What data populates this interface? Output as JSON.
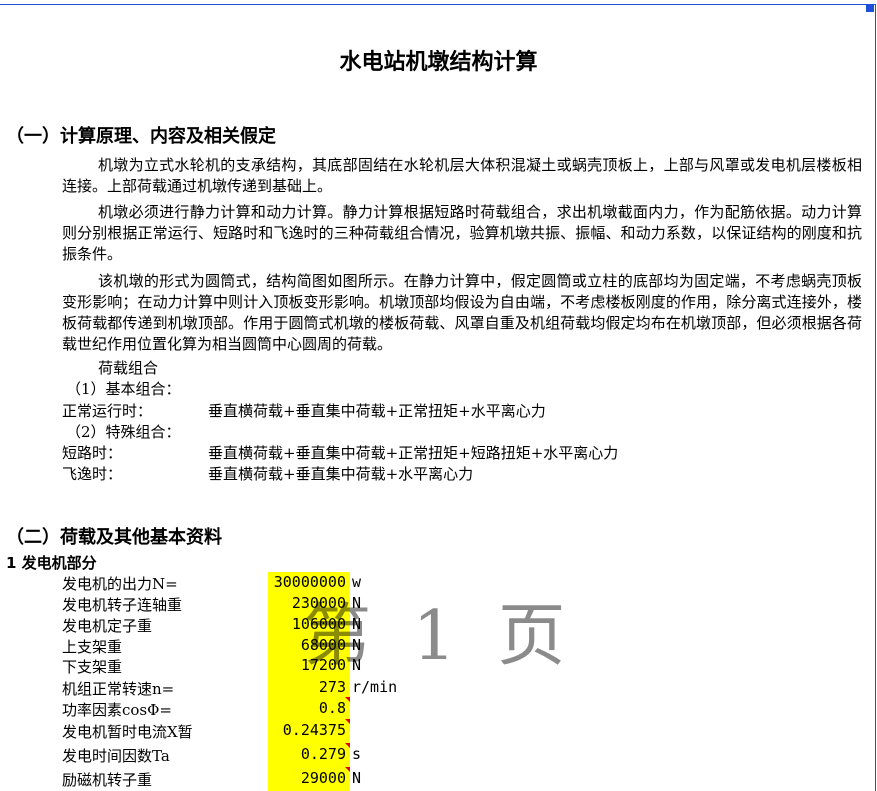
{
  "title": "水电站机墩结构计算",
  "section1": {
    "heading": "（一）计算原理、内容及相关假定",
    "paragraphs": [
      "机墩为立式水轮机的支承结构，其底部固结在水轮机层大体积混凝土或蜗壳顶板上，上部与风罩或发电机层楼板相连接。上部荷载通过机墩传递到基础上。",
      "机墩必须进行静力计算和动力计算。静力计算根据短路时荷载组合，求出机墩截面内力，作为配筋依据。动力计算则分别根据正常运行、短路时和飞逸时的三种荷载组合情况，验算机墩共振、振幅、和动力系数，以保证结构的刚度和抗振条件。",
      "该机墩的形式为圆筒式，结构简图如图所示。在静力计算中，假定圆筒或立柱的底部均为固定端，不考虑蜗壳顶板变形影响；在动力计算中则计入顶板变形影响。机墩顶部均假设为自由端，不考虑楼板刚度的作用，除分离式连接外，楼板荷载都传递到机墩顶部。作用于圆筒式机墩的楼板荷载、风罩自重及机组荷载均假定均布在机墩顶部，但必须根据各荷载世纪作用位置化算为相当圆筒中心圆周的荷载。"
    ],
    "combo_title": "荷载组合",
    "basic_title": "（1）基本组合：",
    "normal_label": "正常运行时：",
    "normal_formula": "垂直横荷载+垂直集中荷载+正常扭矩+水平离心力",
    "special_title": "（2）特殊组合：",
    "short_label": "短路时：",
    "short_formula": "垂直横荷载+垂直集中荷载+正常扭矩+短路扭矩+水平离心力",
    "runaway_label": "飞逸时：",
    "runaway_formula": "垂直横荷载+垂直集中荷载+水平离心力"
  },
  "section2": {
    "heading": "（二）荷载及其他基本资料",
    "sub_heading": "1  发电机部分",
    "rows": [
      {
        "label": "发电机的出力N=",
        "value": "30000000",
        "unit": "w"
      },
      {
        "label": "发电机转子连轴重",
        "value": "230000",
        "unit": "N"
      },
      {
        "label": "发电机定子重",
        "value": "106000",
        "unit": "N"
      },
      {
        "label": "上支架重",
        "value": "68000",
        "unit": "N"
      },
      {
        "label": "下支架重",
        "value": "17200",
        "unit": "N"
      },
      {
        "label": "机组正常转速n=",
        "value": "273",
        "unit": "r/min"
      },
      {
        "label": "功率因素cosΦ=",
        "value": "0.8",
        "unit": ""
      },
      {
        "label": "发电机暂时电流X暂",
        "value": "0.24375",
        "unit": ""
      },
      {
        "label": "发电时间因数Ta",
        "value": "0.279",
        "unit": "s"
      },
      {
        "label": "励磁机转子重",
        "value": "29000",
        "unit": "N"
      }
    ]
  },
  "watermark": "第 1 页",
  "colors": {
    "highlight": "#ffff00",
    "border": "#1d4fd8",
    "comment_marker": "#e60000"
  }
}
